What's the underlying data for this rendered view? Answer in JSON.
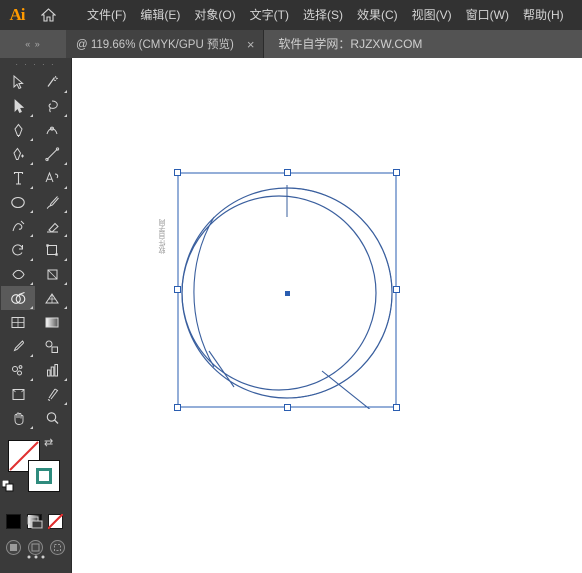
{
  "app": {
    "name": "Ai",
    "logo_color": "#ff9a00"
  },
  "menubar": {
    "home_icon": "home-icon",
    "items": [
      {
        "label": "文件(F)"
      },
      {
        "label": "编辑(E)"
      },
      {
        "label": "对象(O)"
      },
      {
        "label": "文字(T)"
      },
      {
        "label": "选择(S)"
      },
      {
        "label": "效果(C)"
      },
      {
        "label": "视图(V)"
      },
      {
        "label": "窗口(W)"
      },
      {
        "label": "帮助(H)"
      }
    ]
  },
  "tabbar": {
    "arrows": "«  »",
    "tab_label": "@ 119.66% (CMYK/GPU 预览)",
    "close_label": "×",
    "watermark": "软件自学网：RJZXW.COM"
  },
  "toolbar": {
    "grip": "· · · · ·",
    "tools": [
      {
        "name": "selection-tool"
      },
      {
        "name": "magic-wand-tool"
      },
      {
        "name": "direct-selection-tool"
      },
      {
        "name": "lasso-tool"
      },
      {
        "name": "pen-tool"
      },
      {
        "name": "curvature-tool"
      },
      {
        "name": "add-anchor-point-tool"
      },
      {
        "name": "line-segment-tool"
      },
      {
        "name": "type-tool"
      },
      {
        "name": "touch-type-tool"
      },
      {
        "name": "ellipse-tool"
      },
      {
        "name": "paintbrush-tool"
      },
      {
        "name": "shaper-tool"
      },
      {
        "name": "pencil-tool"
      },
      {
        "name": "rotate-tool"
      },
      {
        "name": "scale-tool"
      },
      {
        "name": "width-tool"
      },
      {
        "name": "free-transform-tool"
      },
      {
        "name": "shape-builder-tool"
      },
      {
        "name": "perspective-grid-tool"
      },
      {
        "name": "mesh-tool"
      },
      {
        "name": "gradient-tool"
      },
      {
        "name": "eyedropper-tool"
      },
      {
        "name": "blend-tool"
      },
      {
        "name": "symbol-sprayer-tool"
      },
      {
        "name": "column-graph-tool"
      },
      {
        "name": "artboard-tool"
      },
      {
        "name": "slice-tool"
      },
      {
        "name": "hand-tool"
      },
      {
        "name": "zoom-tool"
      }
    ],
    "active_tool": "shape-builder-tool",
    "colors": {
      "fill": "#ffffff",
      "fill_none": true,
      "stroke": "#2e8b7d",
      "swap_label": "⇄",
      "mini_black": "#000000",
      "mini_gradient": "#808080",
      "mini_none": "#ffffff"
    },
    "bottom": {
      "arrange_icon": "arrange-icon",
      "more_icon": "more-options-icon"
    }
  },
  "canvas": {
    "selection_color": "#2a5db0",
    "artwork_label": "软件自学网",
    "shape_name": "circle-with-halftone-arc",
    "handles": 8
  }
}
